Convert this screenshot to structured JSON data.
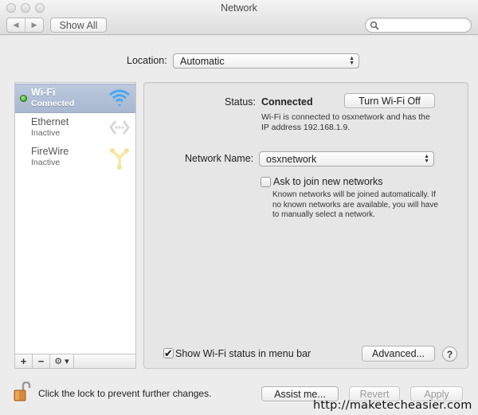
{
  "window": {
    "title": "Network",
    "show_all_label": "Show All",
    "back_glyph": "◀",
    "forward_glyph": "▶",
    "search_placeholder": ""
  },
  "location": {
    "label": "Location:",
    "value": "Automatic"
  },
  "sidebar": {
    "services": [
      {
        "name": "Wi-Fi",
        "state": "Connected",
        "icon": "wifi-icon",
        "selected": true,
        "status_color": "#3cb12a"
      },
      {
        "name": "Ethernet",
        "state": "Inactive",
        "icon": "ethernet-icon",
        "selected": false
      },
      {
        "name": "FireWire",
        "state": "Inactive",
        "icon": "firewire-icon",
        "selected": false
      }
    ],
    "add_label": "+",
    "remove_label": "−",
    "action_label": "⚙ ▾"
  },
  "detail": {
    "status_label": "Status:",
    "status_value": "Connected",
    "turn_off_label": "Turn Wi-Fi Off",
    "status_description": "Wi-Fi is connected to osxnetwork and has the IP address 192.168.1.9.",
    "network_name_label": "Network Name:",
    "network_name_value": "osxnetwork",
    "ask_join_label": "Ask to join new networks",
    "ask_join_checked": false,
    "ask_join_description": "Known networks will be joined automatically. If no known networks are available, you will have to manually select a network.",
    "show_status_label": "Show Wi-Fi status in menu bar",
    "show_status_checked": true,
    "check_glyph": "✔",
    "advanced_label": "Advanced...",
    "help_label": "?"
  },
  "footer": {
    "lock_text": "Click the lock to prevent further changes.",
    "assist_label": "Assist me...",
    "revert_label": "Revert",
    "apply_label": "Apply",
    "watermark": "http://maketecheasier.com"
  }
}
